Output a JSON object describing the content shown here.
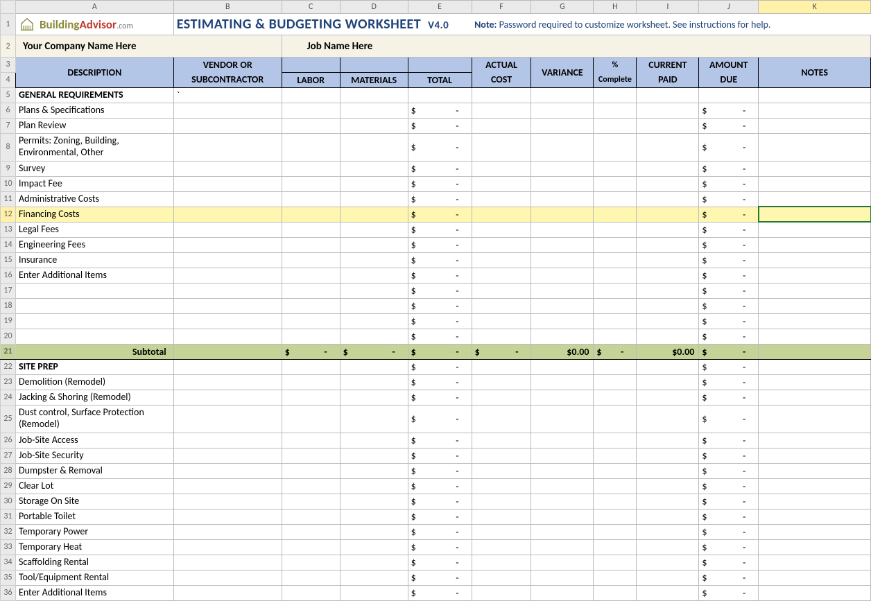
{
  "columns": [
    "A",
    "B",
    "C",
    "D",
    "E",
    "F",
    "G",
    "H",
    "I",
    "J",
    "K"
  ],
  "logo": {
    "building": "Building",
    "advisor": "Advisor",
    "com": ".com"
  },
  "title": "ESTIMATING &  BUDGETING WORKSHEET",
  "version": "V4.0",
  "note_label": "Note:",
  "note_text": "Password required to customize worksheet. See instructions for help.",
  "company_label": "Your Company Name Here",
  "job_label": "Job Name Here",
  "headers": {
    "description": "DESCRIPTION",
    "vendor1": "VENDOR  OR",
    "vendor2": "SUBCONTRACTOR",
    "labor": "LABOR",
    "materials": "MATERIALS",
    "total": "TOTAL",
    "actual1": "ACTUAL",
    "actual2": "COST",
    "variance": "VARIANCE",
    "pct1": "%",
    "pct2": "Complete",
    "paid1": "CURRENT",
    "paid2": "PAID",
    "due1": "AMOUNT",
    "due2": "DUE",
    "notes": "NOTES"
  },
  "money_symbol": "$",
  "dash": "-",
  "subtotal_label": "Subtotal",
  "zero_dollar": "$0.00",
  "rows": [
    {
      "n": 5,
      "desc": "GENERAL REQUIREMENTS",
      "bold": true,
      "b_tick": true,
      "money": false
    },
    {
      "n": 6,
      "desc": "Plans & Specifications",
      "money": true
    },
    {
      "n": 7,
      "desc": "Plan Review",
      "money": true
    },
    {
      "n": 8,
      "desc": "Permits: Zoning, Building, Environmental, Other",
      "tall": true,
      "money": true
    },
    {
      "n": 9,
      "desc": "Survey",
      "money": true
    },
    {
      "n": 10,
      "desc": "Impact Fee",
      "money": true
    },
    {
      "n": 11,
      "desc": "Administrative Costs",
      "money": true
    },
    {
      "n": 12,
      "desc": "Financing Costs",
      "money": true,
      "highlight": true,
      "selectedK": true
    },
    {
      "n": 13,
      "desc": "Legal Fees",
      "money": true
    },
    {
      "n": 14,
      "desc": "Engineering Fees",
      "money": true
    },
    {
      "n": 15,
      "desc": "Insurance",
      "money": true
    },
    {
      "n": 16,
      "desc": "Enter Additional Items",
      "money": true
    },
    {
      "n": 17,
      "desc": "",
      "money": true
    },
    {
      "n": 18,
      "desc": "",
      "money": true
    },
    {
      "n": 19,
      "desc": "",
      "money": true
    },
    {
      "n": 20,
      "desc": "",
      "money": true
    },
    {
      "n": 21,
      "subtotal": true
    },
    {
      "n": 22,
      "desc": "SITE PREP",
      "bold": true,
      "money": true
    },
    {
      "n": 23,
      "desc": "Demolition (Remodel)",
      "money": true
    },
    {
      "n": 24,
      "desc": "Jacking & Shoring (Remodel)",
      "money": true
    },
    {
      "n": 25,
      "desc": "Dust control, Surface Protection (Remodel)",
      "tall": true,
      "money": true
    },
    {
      "n": 26,
      "desc": "Job-Site Access",
      "money": true
    },
    {
      "n": 27,
      "desc": "Job-Site Security",
      "money": true
    },
    {
      "n": 28,
      "desc": "Dumpster & Removal",
      "money": true
    },
    {
      "n": 29,
      "desc": "Clear Lot",
      "money": true
    },
    {
      "n": 30,
      "desc": "Storage On Site",
      "money": true
    },
    {
      "n": 31,
      "desc": "Portable Toilet",
      "money": true
    },
    {
      "n": 32,
      "desc": "Temporary Power",
      "money": true
    },
    {
      "n": 33,
      "desc": "Temporary Heat",
      "money": true
    },
    {
      "n": 34,
      "desc": "Scaffolding Rental",
      "money": true
    },
    {
      "n": 35,
      "desc": "Tool/Equipment Rental",
      "money": true
    },
    {
      "n": 36,
      "desc": "Enter Additional Items",
      "money": true
    }
  ]
}
